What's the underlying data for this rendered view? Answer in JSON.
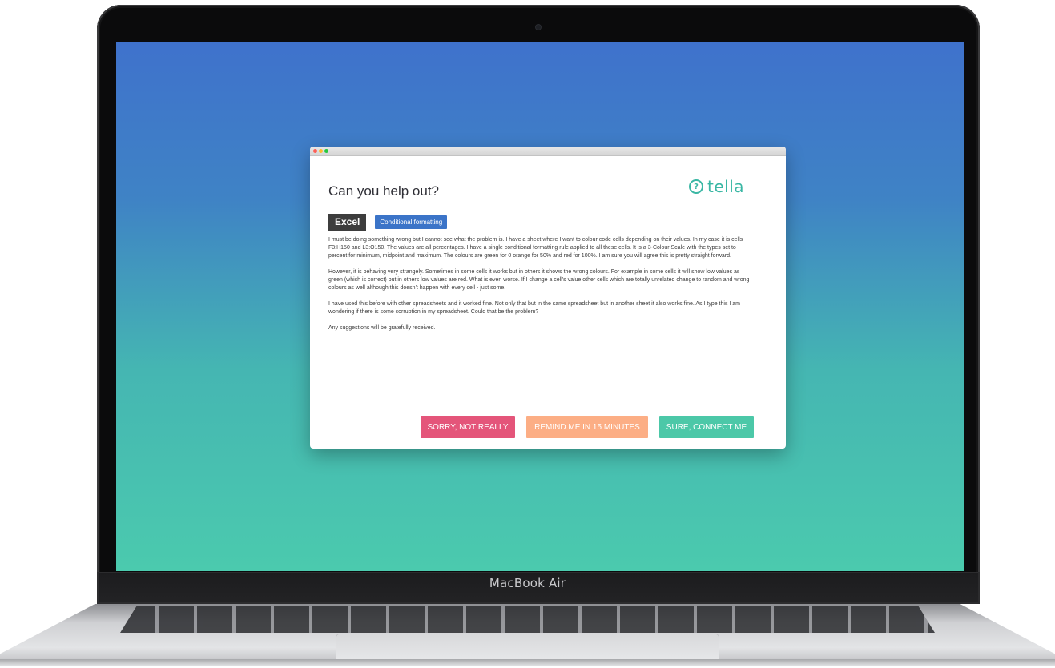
{
  "device": {
    "brand_label": "MacBook Air"
  },
  "window": {
    "heading": "Can you help out?",
    "logo_text": "tella",
    "tags": {
      "app": "Excel",
      "topic": "Conditional formatting"
    },
    "paragraphs": [
      "I must be doing something wrong but I cannot see what the problem is. I have a sheet where I want to colour code cells depending on their values. In my case it is cells F3:H150 and L3:O150. The values are all percentages. I have a single conditional formatting rule applied to all these cells. It is a 3-Colour Scale with the types set to percent for minimum, midpoint and maximum. The colours are green for 0 orange for 50% and red for 100%. I am sure you will agree this is pretty straight forward.",
      "However, it is behaving very strangely. Sometimes in some cells it works but in others it shows the wrong colours. For example in some cells it will show low values as green (which is correct) but in others low values are red. What is even worse. If I change a cell's value other cells which are totally unrelated change to random and wrong colours as well although this doesn't happen with every cell - just some.",
      "I have used this before with other spreadsheets and it worked fine. Not only that but in the same spreadsheet but in another sheet it also works fine. As I type this I am wondering if there is some corruption in my spreadsheet. Could that be the problem?",
      "Any suggestions will be gratefully received."
    ],
    "buttons": {
      "decline": "SORRY, NOT REALLY",
      "remind": "REMIND ME IN 15 MINUTES",
      "accept": "SURE, CONNECT ME"
    }
  },
  "colors": {
    "decline": "#e4557a",
    "remind": "#fcae85",
    "accept": "#4cc8a8",
    "brand": "#3ab7a4",
    "topic_tag": "#3b74c8"
  }
}
